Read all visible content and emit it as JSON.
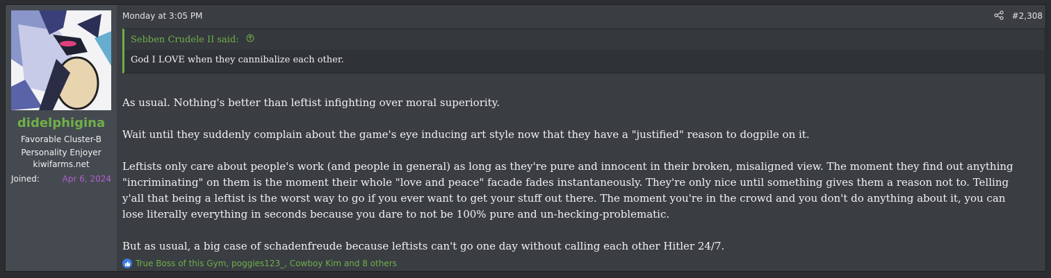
{
  "user": {
    "name": "didelphigina",
    "title_lines": [
      "Favorable Cluster-B",
      "Personality Enjoyer"
    ],
    "site": "kiwifarms.net",
    "joined_label": "Joined:",
    "joined_date": "Apr 6, 2024"
  },
  "post": {
    "date": "Monday at 3:05 PM",
    "number": "#2,308",
    "share_icon": "share-icon",
    "quote": {
      "author_said": "Sebben Crudele II said:",
      "expand_icon": "arrow-up-circle-icon",
      "text": "God I LOVE when they cannibalize each other."
    },
    "paragraphs": [
      "As usual. Nothing's better than leftist infighting over moral superiority.",
      "Wait until they suddenly complain about the game's eye inducing art style now that they have a \"justified\" reason to dogpile on it.",
      "Leftists only care about people's work (and people in general) as long as they're pure and innocent in their broken, misaligned view. The moment they find out anything \"incriminating\" on them is the moment their whole \"love and peace\" facade fades instantaneously. They're only nice until something gives them a reason not to. Telling y'all that being a leftist is the worst way to go if you ever want to get your stuff out there. The moment you're in the crowd and you don't do anything about it, you can lose literally everything in seconds because you dare to not be 100% pure and un-hecking-problematic.",
      "But as usual, a big case of schadenfreude because leftists can't go one day without calling each other Hitler 24/7."
    ],
    "reactions": "True Boss of this Gym, poggies123_, Cowboy Kim and 8 others"
  },
  "colors": {
    "accent_green": "#6fb04a",
    "joined_purple": "#b35fd1",
    "like_blue": "#3b7de3"
  }
}
